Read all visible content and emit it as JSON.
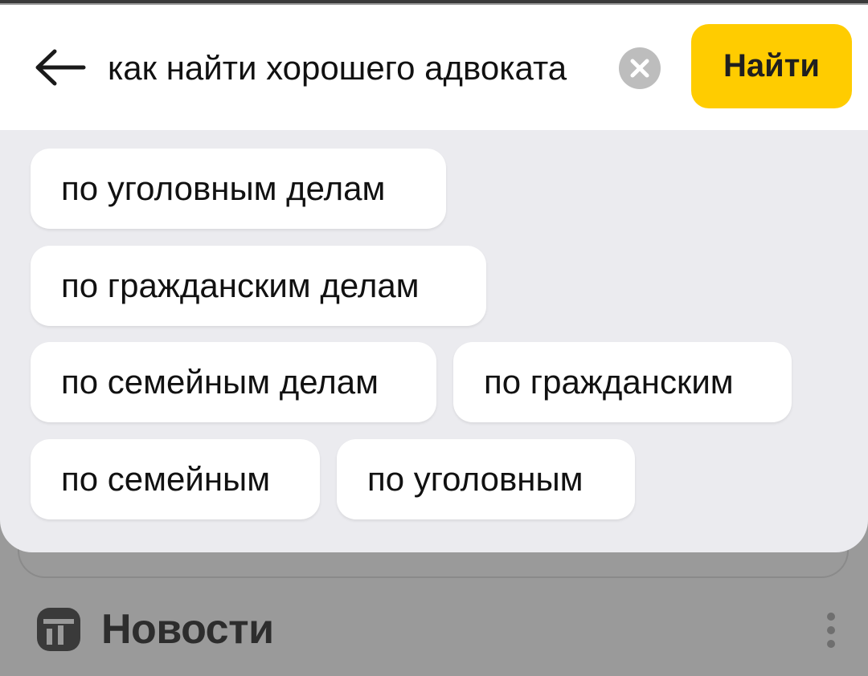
{
  "search": {
    "query": "как найти хорошего адвоката",
    "submit_label": "Найти"
  },
  "suggestions": [
    "по уголовным делам",
    "по гражданским делам",
    "по семейным делам",
    "по гражданским",
    "по семейным",
    "по уголовным"
  ],
  "background": {
    "news_title": "Новости"
  },
  "colors": {
    "accent": "#ffcc00",
    "panel_bg": "#ebebef",
    "overlay_bg": "#9a9a9a"
  },
  "icons": {
    "back": "arrow-left-icon",
    "clear": "close-circle-icon",
    "news": "news-logo-icon",
    "more": "more-vertical-icon"
  }
}
